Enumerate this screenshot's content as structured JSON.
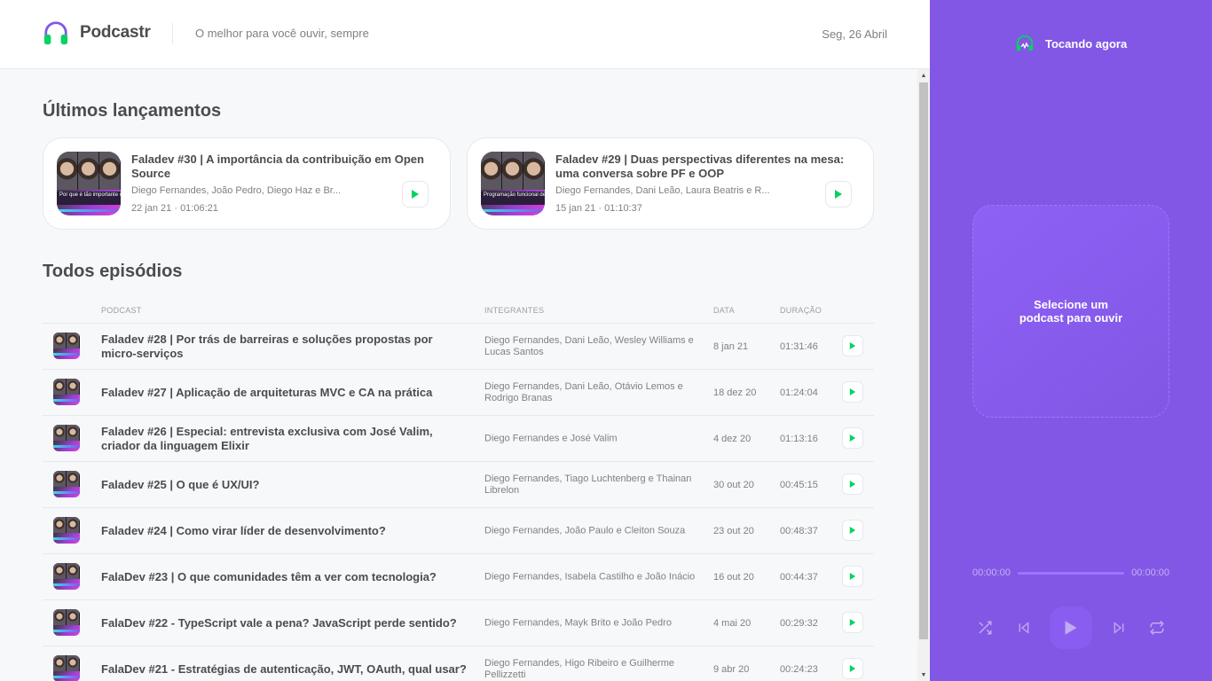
{
  "header": {
    "logo_text": "Podcastr",
    "tagline": "O melhor para você ouvir, sempre",
    "date": "Seg, 26 Abril"
  },
  "latest": {
    "title": "Últimos lançamentos",
    "episodes": [
      {
        "title": "Faladev #30 | A importância da contribuição em Open Source",
        "members": "Diego Fernandes, João Pedro, Diego Haz e Br...",
        "date": "22 jan 21",
        "duration": "01:06:21",
        "thumb_text": "Por que é tão importante contribuir em Open Source"
      },
      {
        "title": "Faladev #29 | Duas perspectivas diferentes na mesa: uma conversa sobre PF e OOP",
        "members": "Diego Fernandes, Dani Leão, Laura Beatris e R...",
        "date": "15 jan 21",
        "duration": "01:10:37",
        "thumb_text": "Programação funcional devs orientados a objetos"
      }
    ]
  },
  "all": {
    "title": "Todos episódios",
    "columns": [
      "Podcast",
      "Integrantes",
      "Data",
      "Duração"
    ],
    "episodes": [
      {
        "title": "Faladev #28 | Por trás de barreiras e soluções propostas por micro-serviços",
        "members": "Diego Fernandes, Dani Leão, Wesley Williams e Lucas Santos",
        "date": "8 jan 21",
        "duration": "01:31:46"
      },
      {
        "title": "Faladev #27 | Aplicação de arquiteturas MVC e CA na prática",
        "members": "Diego Fernandes, Dani Leão, Otávio Lemos e Rodrigo Branas",
        "date": "18 dez 20",
        "duration": "01:24:04"
      },
      {
        "title": "Faladev #26 | Especial: entrevista exclusiva com José Valim, criador da linguagem Elixir",
        "members": "Diego Fernandes e José Valim",
        "date": "4 dez 20",
        "duration": "01:13:16"
      },
      {
        "title": "Faladev #25 | O que é UX/UI?",
        "members": "Diego Fernandes, Tiago Luchtenberg e Thainan Librelon",
        "date": "30 out 20",
        "duration": "00:45:15"
      },
      {
        "title": "Faladev #24 | Como virar líder de desenvolvimento?",
        "members": "Diego Fernandes, João Paulo e Cleiton Souza",
        "date": "23 out 20",
        "duration": "00:48:37"
      },
      {
        "title": "FalaDev #23 | O que comunidades têm a ver com tecnologia?",
        "members": "Diego Fernandes, Isabela Castilho e João Inácio",
        "date": "16 out 20",
        "duration": "00:44:37"
      },
      {
        "title": "FalaDev #22 - TypeScript vale a pena? JavaScript perde sentido?",
        "members": "Diego Fernandes, Mayk Brito e João Pedro",
        "date": "4 mai 20",
        "duration": "00:29:32"
      },
      {
        "title": "FalaDev #21 - Estratégias de autenticação, JWT, OAuth, qual usar?",
        "members": "Diego Fernandes, Higo Ribeiro e Guilherme Pellizzetti",
        "date": "9 abr 20",
        "duration": "00:24:23"
      }
    ]
  },
  "player": {
    "header": "Tocando agora",
    "empty_line1": "Selecione um",
    "empty_line2": "podcast para ouvir",
    "current_time": "00:00:00",
    "total_time": "00:00:00",
    "progress": 0
  },
  "colors": {
    "accent": "#8257e5",
    "play_green": "#04d361",
    "text": "#494d4b",
    "muted": "#808080"
  }
}
